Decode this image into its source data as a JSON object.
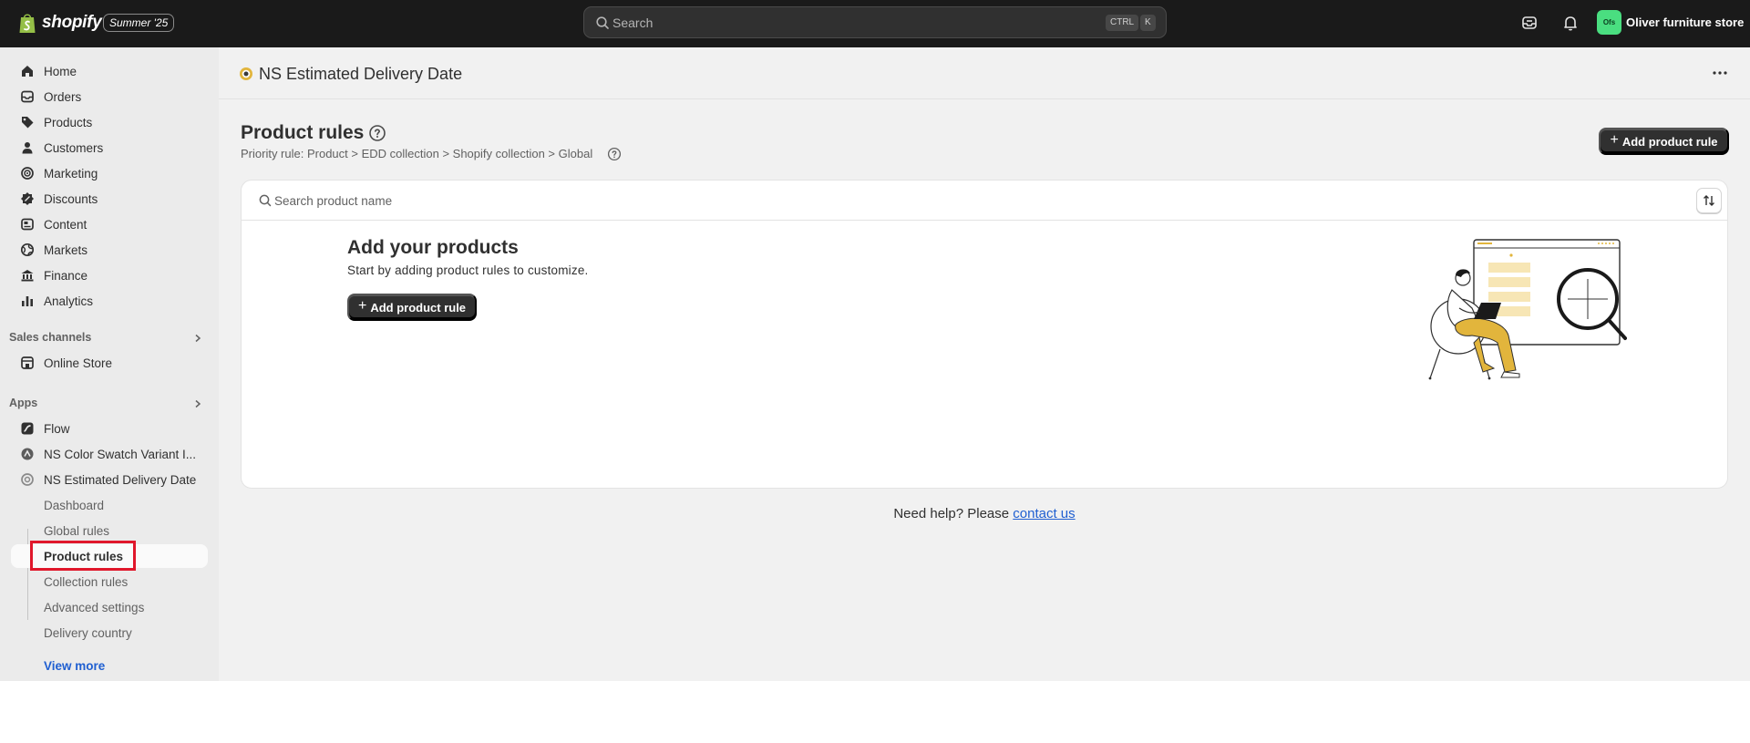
{
  "topbar": {
    "logo_text": "shopify",
    "season_badge": "Summer '25",
    "search_placeholder": "Search",
    "shortcut_ctrl": "CTRL",
    "shortcut_k": "K",
    "store_initials": "Ofs",
    "store_name": "Oliver furniture store"
  },
  "sidebar": {
    "items": [
      {
        "label": "Home",
        "icon": "home-icon"
      },
      {
        "label": "Orders",
        "icon": "orders-icon"
      },
      {
        "label": "Products",
        "icon": "tag-icon"
      },
      {
        "label": "Customers",
        "icon": "person-icon"
      },
      {
        "label": "Marketing",
        "icon": "target-icon"
      },
      {
        "label": "Discounts",
        "icon": "discount-icon"
      },
      {
        "label": "Content",
        "icon": "content-icon"
      },
      {
        "label": "Markets",
        "icon": "globe-icon"
      },
      {
        "label": "Finance",
        "icon": "bank-icon"
      },
      {
        "label": "Analytics",
        "icon": "chart-icon"
      }
    ],
    "sales_channels_heading": "Sales channels",
    "online_store": "Online Store",
    "apps_heading": "Apps",
    "apps": [
      {
        "label": "Flow"
      },
      {
        "label": "NS Color Swatch Variant I..."
      },
      {
        "label": "NS Estimated Delivery Date"
      }
    ],
    "app_sub_items": [
      {
        "label": "Dashboard"
      },
      {
        "label": "Global rules"
      },
      {
        "label": "Product rules"
      },
      {
        "label": "Collection rules"
      },
      {
        "label": "Advanced settings"
      },
      {
        "label": "Delivery country"
      }
    ],
    "active_sub_item": "Product rules",
    "view_more": "View more"
  },
  "app_header": {
    "title": "NS Estimated Delivery Date"
  },
  "page": {
    "title": "Product rules",
    "priority_rule": "Priority rule: Product > EDD collection > Shopify collection > Global",
    "add_button": "Add product rule",
    "search_placeholder": "Search product name",
    "empty_title": "Add your products",
    "empty_subtitle": "Start by adding product rules to customize.",
    "empty_button": "Add product rule",
    "help_text": "Need help? Please",
    "help_link": "contact us"
  },
  "colors": {
    "topbar_bg": "#1a1a1a",
    "sidebar_bg": "#ebebeb",
    "main_bg": "#f1f1f1",
    "primary_button": "#303030",
    "link": "#1f5fd1",
    "highlight": "#e0172b",
    "illustration_accent": "#e2b53c"
  }
}
